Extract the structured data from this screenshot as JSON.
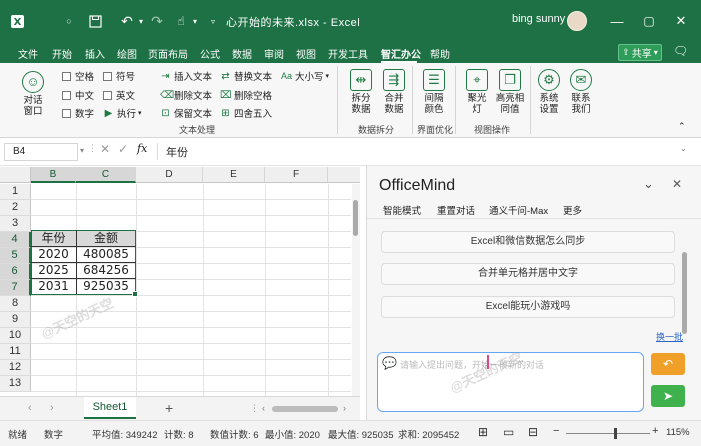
{
  "titlebar": {
    "filename": "心开始的未来.xlsx - Excel",
    "user": "bing sunny",
    "icons": [
      "excel-logo",
      "save",
      "undo",
      "redo",
      "touch-mode",
      "customize"
    ],
    "controls": [
      "minimize",
      "maximize",
      "close"
    ]
  },
  "tabs": [
    "文件",
    "开始",
    "插入",
    "绘图",
    "页面布局",
    "公式",
    "数据",
    "审阅",
    "视图",
    "开发工具",
    "智汇办公",
    "帮助"
  ],
  "active_tab": "智汇办公",
  "share_label": "共享",
  "ribbon": {
    "dialog_label": "对话\n窗口",
    "checks": [
      {
        "label": "空格",
        "checked": false
      },
      {
        "label": "符号",
        "checked": false
      },
      {
        "label": "中文",
        "checked": false
      },
      {
        "label": "英文",
        "checked": false
      },
      {
        "label": "数字",
        "checked": false
      }
    ],
    "execute_label": "执行",
    "text_ops": [
      "插入文本",
      "删除文本",
      "保留文本",
      "替换文本",
      "删除空格",
      "四舍五入"
    ],
    "case_label": "大小写",
    "group_text": "文本处理",
    "split_label": "拆分\n数据",
    "merge_label": "合并\n数据",
    "group_split": "数据拆分",
    "spacing_label": "间隔\n颜色",
    "group_ui": "界面优化",
    "spotlight_label": "聚光\n灯",
    "highlight_label": "高亮相\n同值",
    "group_view": "视图操作",
    "settings_label": "系统\n设置",
    "contact_label": "联系\n我们"
  },
  "formula": {
    "namebox": "B4",
    "fx": "fx",
    "content": "年份"
  },
  "grid": {
    "columns": [
      "B",
      "C",
      "D",
      "E",
      "F"
    ],
    "rows": [
      "1",
      "2",
      "3",
      "4",
      "5",
      "6",
      "7",
      "8",
      "9",
      "10",
      "11",
      "12",
      "13"
    ],
    "table": [
      [
        "年份",
        "金额"
      ],
      [
        "2020",
        "480085"
      ],
      [
        "2025",
        "684256"
      ],
      [
        "2031",
        "925035"
      ]
    ]
  },
  "sheet": {
    "name": "Sheet1",
    "add": "+"
  },
  "status": {
    "ready": "就绪",
    "mode": "数字",
    "avg": "平均值: 349242",
    "count": "计数: 8",
    "numcount": "数值计数: 6",
    "min": "最小值: 2020",
    "max": "最大值: 925035",
    "sum": "求和: 2095452",
    "zoom": "115%"
  },
  "panel": {
    "title": "OfficeMind",
    "tabs": [
      "智能模式",
      "重置对话",
      "通义千问-Max",
      "更多"
    ],
    "suggestions": [
      "Excel和微信数据怎么同步",
      "合并单元格并居中文字",
      "Excel能玩小游戏吗"
    ],
    "next": "换一批",
    "placeholder": "请输入提出问题，开始一段新的对话",
    "colors": {
      "retry": "#f0a028",
      "send": "#3fb24d"
    }
  },
  "watermark": "@天空的天空"
}
